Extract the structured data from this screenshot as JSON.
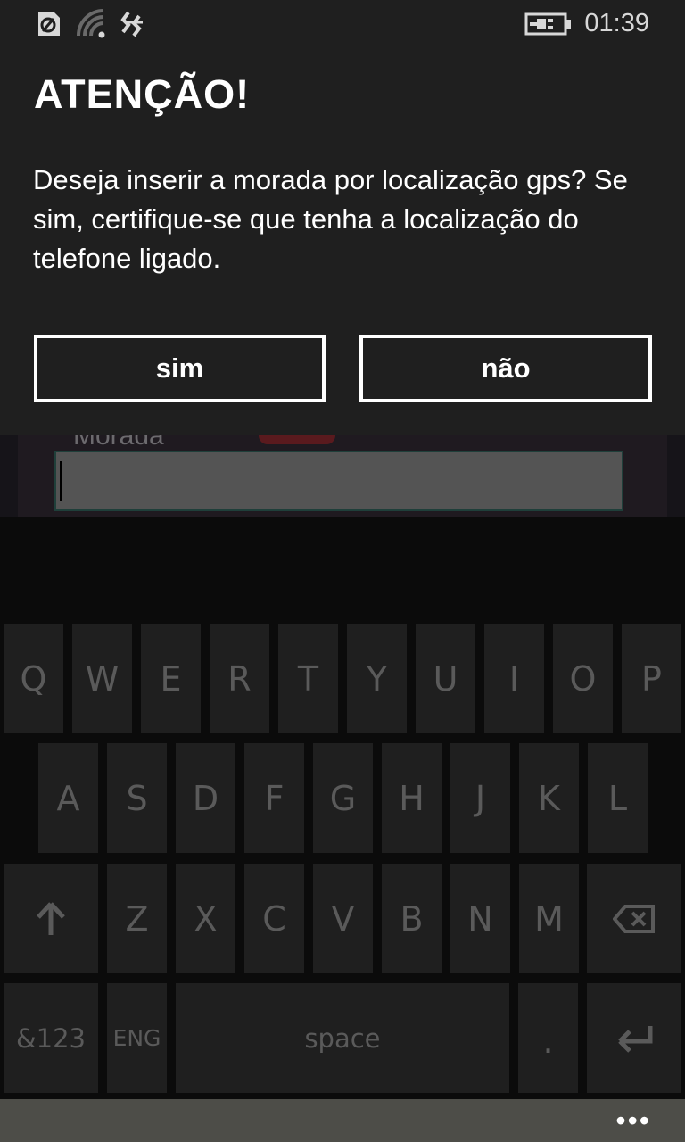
{
  "status_bar": {
    "icons": [
      "nfc-icon",
      "wifi-icon",
      "data-sync-icon",
      "battery-charging-icon"
    ],
    "time": "01:39"
  },
  "dialog": {
    "title": "ATENÇÃO!",
    "message": "Deseja inserir a morada por localização gps? Se sim, certifique-se que tenha a localização do telefone ligado.",
    "buttons": {
      "yes": "sim",
      "no": "não"
    }
  },
  "background_form": {
    "field_label": "Morada",
    "field_value": ""
  },
  "keyboard": {
    "row1": [
      "Q",
      "W",
      "E",
      "R",
      "T",
      "Y",
      "U",
      "I",
      "O",
      "P"
    ],
    "row2": [
      "A",
      "S",
      "D",
      "F",
      "G",
      "H",
      "J",
      "K",
      "L"
    ],
    "row3": [
      "Z",
      "X",
      "C",
      "V",
      "B",
      "N",
      "M"
    ],
    "shift_icon": "shift-arrow-up-icon",
    "backspace_icon": "backspace-icon",
    "symbols_label": "&123",
    "language_label": "ENG",
    "space_label": "space",
    "period_label": ".",
    "enter_icon": "enter-return-icon"
  },
  "app_bar": {
    "more": "•••"
  },
  "colors": {
    "dialog_bg": "#1f1f1f",
    "keyboard_bg": "#0b0b0b",
    "key_bg": "#1f1f1f",
    "key_text": "#5a5a5a",
    "app_bar_bg": "#4d4d48"
  }
}
